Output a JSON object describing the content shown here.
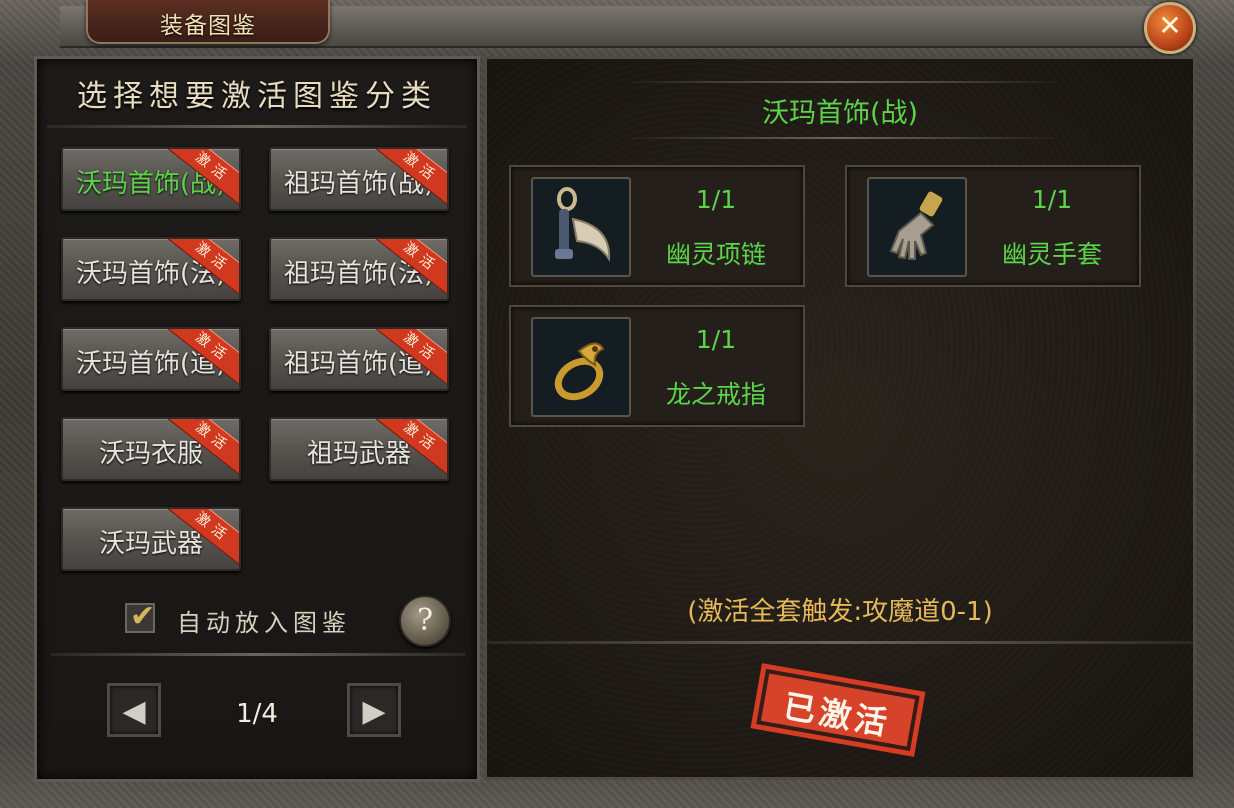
{
  "window": {
    "title": "装备图鉴",
    "close_label": "✕"
  },
  "left": {
    "heading": "选择想要激活图鉴分类",
    "ribbon_text": "激活",
    "categories": [
      {
        "label": "沃玛首饰(战)",
        "selected": true
      },
      {
        "label": "祖玛首饰(战)",
        "selected": false
      },
      {
        "label": "沃玛首饰(法)",
        "selected": false
      },
      {
        "label": "祖玛首饰(法)",
        "selected": false
      },
      {
        "label": "沃玛首饰(道)",
        "selected": false
      },
      {
        "label": "祖玛首饰(道)",
        "selected": false
      },
      {
        "label": "沃玛衣服",
        "selected": false
      },
      {
        "label": "祖玛武器",
        "selected": false
      },
      {
        "label": "沃玛武器",
        "selected": false
      }
    ],
    "auto_place": {
      "label": "自动放入图鉴",
      "checked": true
    },
    "help_label": "?",
    "pager": {
      "current": 1,
      "total": 4,
      "text": "1/4",
      "prev_icon": "◀",
      "next_icon": "▶"
    }
  },
  "right": {
    "title": "沃玛首饰(战)",
    "items": [
      {
        "name": "幽灵项链",
        "count": "1/1",
        "icon": "necklace-icon"
      },
      {
        "name": "幽灵手套",
        "count": "1/1",
        "icon": "glove-icon"
      },
      {
        "name": "龙之戒指",
        "count": "1/1",
        "icon": "ring-icon"
      }
    ],
    "set_bonus": "(激活全套触发:攻魔道0-1)",
    "stamp": "已激活"
  },
  "colors": {
    "green_text": "#5cd44a",
    "gold_text": "#e6b85a",
    "ribbon_red": "#d0391f",
    "stamp_red": "#d6432a"
  }
}
